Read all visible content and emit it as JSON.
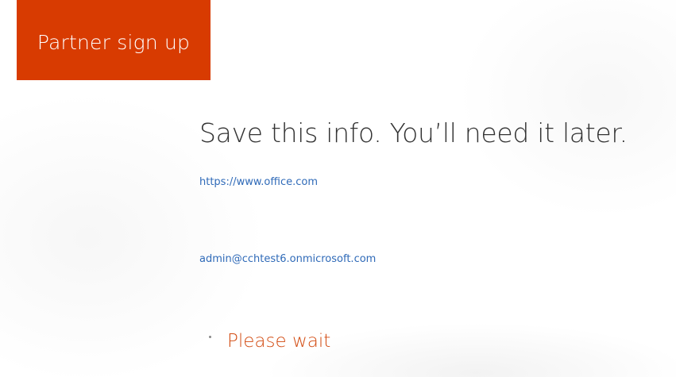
{
  "header": {
    "title": "Partner sign up",
    "accent_color": "#d83b01"
  },
  "main": {
    "heading": "Save this info. You’ll need it later.",
    "signin_url": "https://www.office.com",
    "admin_account": "admin@cchtest6.onmicrosoft.com",
    "status": {
      "icon": "loading-spinner-icon",
      "text": "Please wait",
      "color": "#d24a10"
    }
  }
}
